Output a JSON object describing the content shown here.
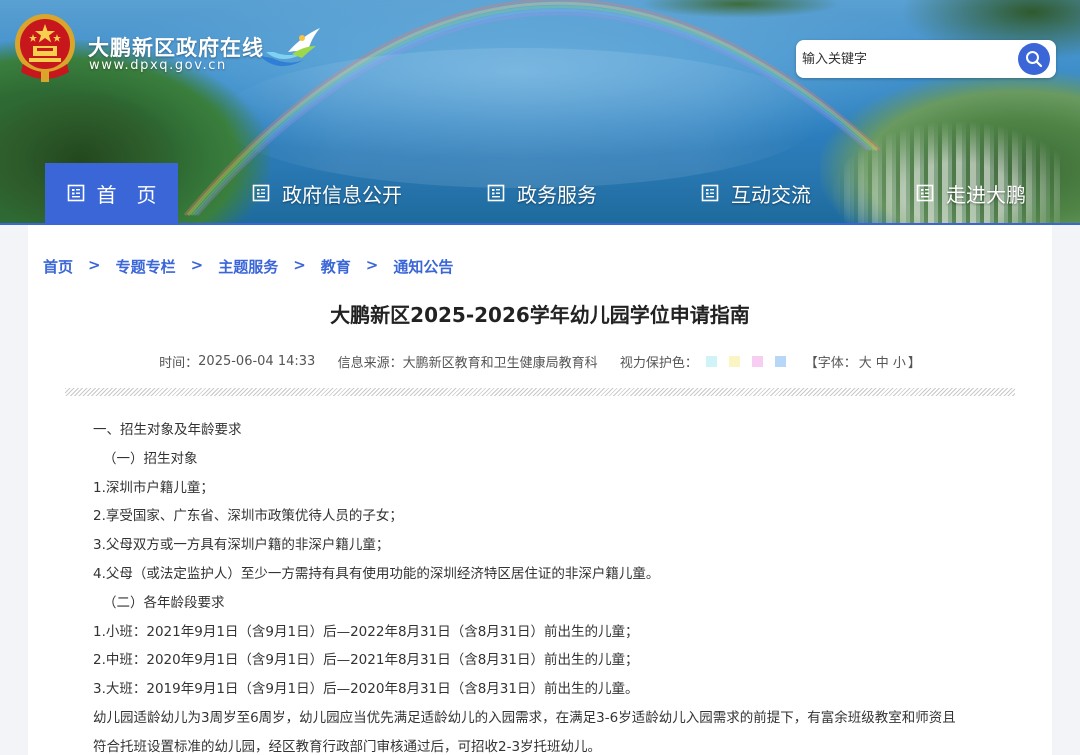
{
  "site": {
    "name": "大鹏新区政府在线",
    "url": "www.dpxq.gov.cn"
  },
  "search": {
    "placeholder": "输入关键字"
  },
  "nav": {
    "items": [
      {
        "label": "首　页",
        "active": true
      },
      {
        "label": "政府信息公开",
        "active": false
      },
      {
        "label": "政务服务",
        "active": false
      },
      {
        "label": "互动交流",
        "active": false
      },
      {
        "label": "走进大鹏",
        "active": false
      }
    ]
  },
  "breadcrumb": {
    "items": [
      "首页",
      "专题专栏",
      "主题服务",
      "教育",
      "通知公告"
    ],
    "separator": ">"
  },
  "article": {
    "title": "大鹏新区2025-2026学年幼儿园学位申请指南",
    "meta": {
      "time_label": "时间：",
      "time": "2025-06-04 14:33",
      "source_label": "信息来源：",
      "source": "大鹏新区教育和卫生健康局教育科",
      "eye_label": "视力保护色：",
      "eye_colors": [
        "#cff3f7",
        "#faf5c2",
        "#f7cdf2",
        "#b8d6f5"
      ],
      "font_open": "【字体：",
      "font_large": "大",
      "font_medium": "中",
      "font_small": "小",
      "font_close": "】"
    },
    "paragraphs": [
      "一、招生对象及年龄要求",
      "（一）招生对象",
      "1.深圳市户籍儿童；",
      "2.享受国家、广东省、深圳市政策优待人员的子女；",
      "3.父母双方或一方具有深圳户籍的非深户籍儿童；",
      "4.父母（或法定监护人）至少一方需持有具有使用功能的深圳经济特区居住证的非深户籍儿童。",
      "（二）各年龄段要求",
      "1.小班：2021年9月1日（含9月1日）后—2022年8月31日（含8月31日）前出生的儿童；",
      "2.中班：2020年9月1日（含9月1日）后—2021年8月31日（含8月31日）前出生的儿童；",
      "3.大班：2019年9月1日（含9月1日）后—2020年8月31日（含8月31日）前出生的儿童。",
      "幼儿园适龄幼儿为3周岁至6周岁，幼儿园应当优先满足适龄幼儿的入园需求，在满足3-6岁适龄幼儿入园需求的前提下，有富余班级教室和师资且",
      "符合托班设置标准的幼儿园，经区教育行政部门审核通过后，可招收2-3岁托班幼儿。"
    ]
  },
  "colors": {
    "accent": "#3a66d8",
    "title_text": "#222222",
    "body_text": "#333333"
  }
}
